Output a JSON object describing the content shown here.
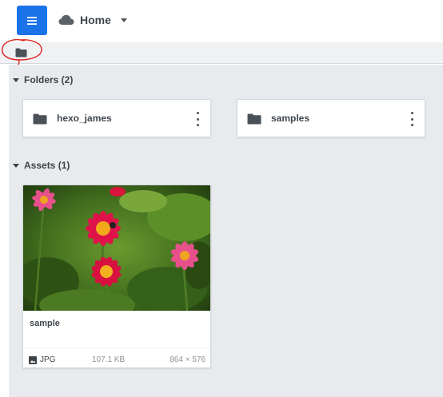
{
  "header": {
    "menu_icon": "hamburger-icon",
    "cloud_icon": "cloud-icon",
    "workspace_label": "Home",
    "accent_color": "#1a73e8"
  },
  "breadcrumb": {
    "root_icon": "folder-icon"
  },
  "folders_section": {
    "title": "Folders (2)",
    "items": [
      {
        "name": "hexo_james"
      },
      {
        "name": "samples"
      }
    ]
  },
  "assets_section": {
    "title": "Assets (1)",
    "items": [
      {
        "name": "sample",
        "type": "JPG",
        "size": "107.1 KB",
        "dimensions": "864 × 576"
      }
    ]
  }
}
